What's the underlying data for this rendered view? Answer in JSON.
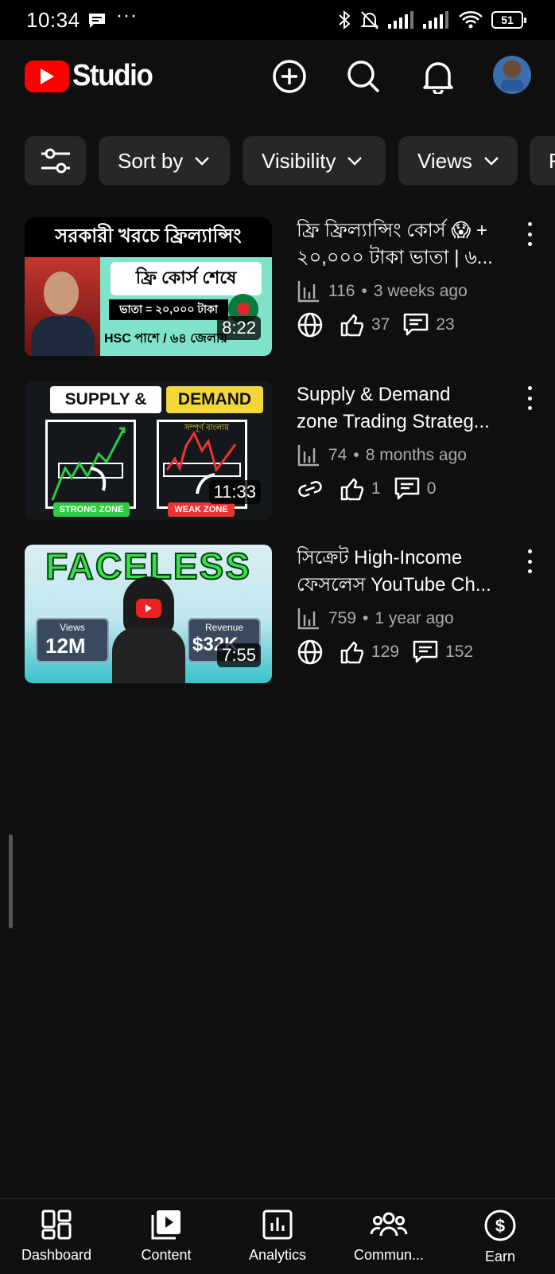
{
  "status_bar": {
    "time": "10:34",
    "dots": "···",
    "battery": "51"
  },
  "header": {
    "brand": "Studio",
    "accent_color": "#ff0000"
  },
  "filters": {
    "settings_icon": "filter-settings-icon",
    "chips": [
      {
        "label": "Sort by"
      },
      {
        "label": "Visibility"
      },
      {
        "label": "Views"
      },
      {
        "label": "F"
      }
    ]
  },
  "videos": [
    {
      "thumb_text": {
        "top": "সরকারী খরচে ফ্রিল্যান্সিং",
        "middle": "ফ্রি কোর্স শেষে",
        "amount": "ভাতা = ২০,০০০ টাকা",
        "bottom": "HSC পাশে / ৬৪ জেলায়"
      },
      "duration": "8:22",
      "title_line1": "ফ্রি ফ্রিল্যান্সিং কোর্স 😱 +",
      "title_line2": "২০,০০০ টাকা ভাতা | ৬...",
      "views": "116",
      "age": "3 weeks ago",
      "visibility_icon": "globe-icon",
      "likes": "37",
      "comments": "23"
    },
    {
      "thumb_text": {
        "left": "SUPPLY &",
        "right": "DEMAND",
        "tag": "সম্পূর্ণ বাংলায়",
        "strong": "STRONG ZONE",
        "weak": "WEAK ZONE"
      },
      "duration": "11:33",
      "title_line1": "Supply & Demand",
      "title_line2": "zone Trading Strateg...",
      "views": "74",
      "age": "8 months ago",
      "visibility_icon": "link-icon",
      "likes": "1",
      "comments": "0"
    },
    {
      "thumb_text": {
        "headline": "FACELESS",
        "views_label": "Views",
        "views_value": "12M",
        "revenue_label": "Revenue",
        "revenue_value": "$32K"
      },
      "duration": "7:55",
      "title_line1": "সিক্রেট High-Income",
      "title_line2": "ফেসলেস YouTube Ch...",
      "views": "759",
      "age": "1 year ago",
      "visibility_icon": "globe-icon",
      "likes": "129",
      "comments": "152"
    }
  ],
  "bottom_nav": [
    {
      "label": "Dashboard",
      "icon": "dashboard-icon"
    },
    {
      "label": "Content",
      "icon": "content-icon"
    },
    {
      "label": "Analytics",
      "icon": "analytics-icon"
    },
    {
      "label": "Commun...",
      "icon": "community-icon"
    },
    {
      "label": "Earn",
      "icon": "earn-icon"
    }
  ]
}
